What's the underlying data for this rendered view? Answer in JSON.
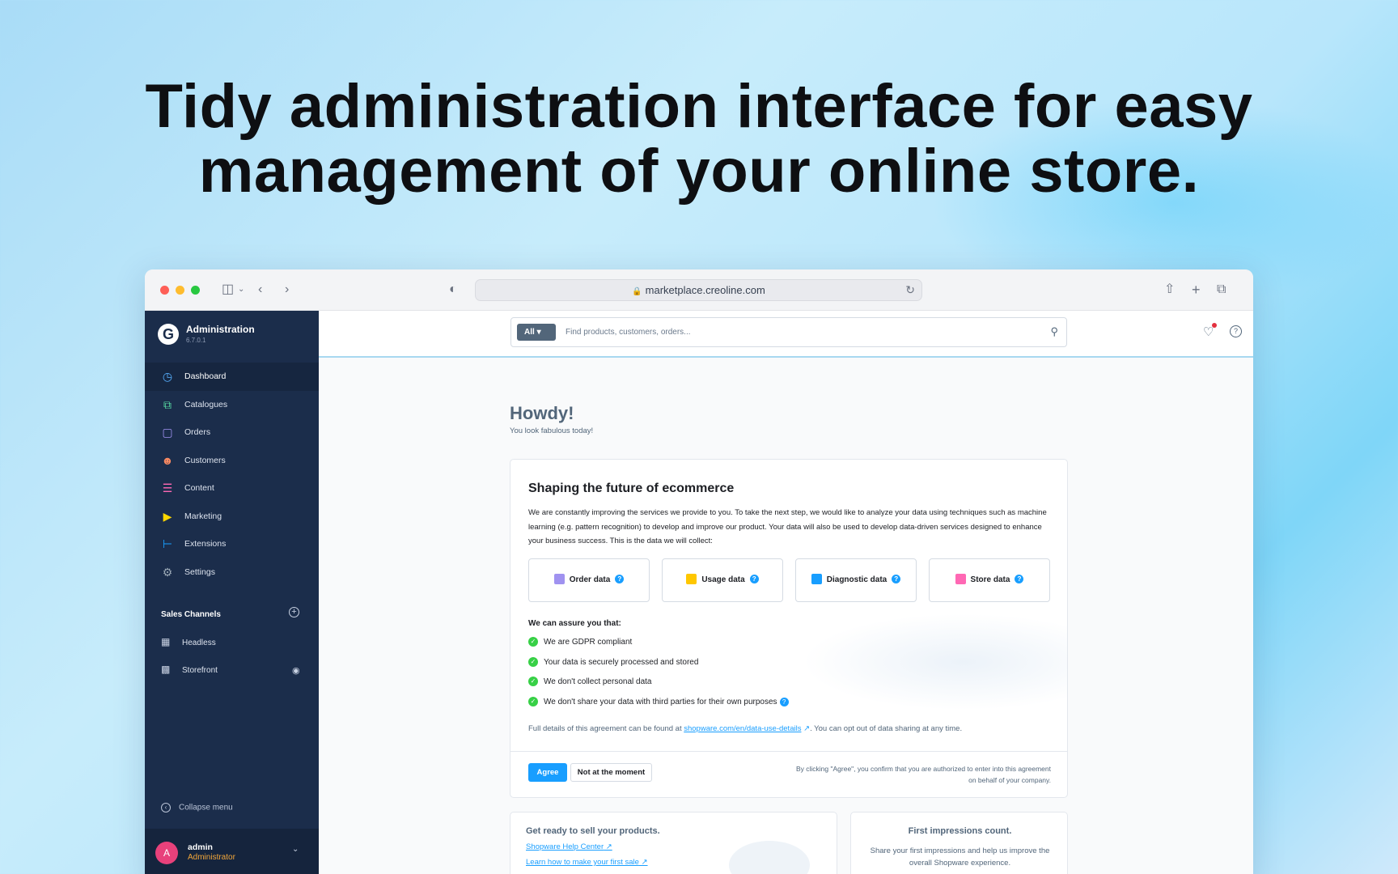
{
  "headline": {
    "line1": "Tidy administration interface for easy",
    "line2": "management of your online store."
  },
  "browser": {
    "url": "marketplace.creoline.com"
  },
  "sidebar": {
    "brand_title": "Administration",
    "brand_version": "6.7.0.1",
    "items": [
      {
        "label": "Dashboard",
        "icon": "gauge-icon",
        "color": "#57b0ff"
      },
      {
        "label": "Catalogues",
        "icon": "copy-icon",
        "color": "#57d9a3"
      },
      {
        "label": "Orders",
        "icon": "bag-icon",
        "color": "#a092f0"
      },
      {
        "label": "Customers",
        "icon": "users-icon",
        "color": "#f88962"
      },
      {
        "label": "Content",
        "icon": "content-icon",
        "color": "#ff68b4"
      },
      {
        "label": "Marketing",
        "icon": "megaphone-icon",
        "color": "#ffd700"
      },
      {
        "label": "Extensions",
        "icon": "plug-icon",
        "color": "#189eff"
      },
      {
        "label": "Settings",
        "icon": "gear-icon",
        "color": "#9aa8b5"
      }
    ],
    "sales_channels_title": "Sales Channels",
    "sales_channels": [
      {
        "label": "Headless",
        "icon": "basket-icon"
      },
      {
        "label": "Storefront",
        "icon": "storefront-icon"
      }
    ],
    "collapse_label": "Collapse menu",
    "user": {
      "initial": "A",
      "name": "admin",
      "role": "Administrator"
    }
  },
  "topbar": {
    "search_scope": "All",
    "search_placeholder": "Find products, customers, orders..."
  },
  "main": {
    "greeting": "Howdy!",
    "subgreeting": "You look fabulous today!",
    "consent": {
      "title": "Shaping the future of ecommerce",
      "intro": "We are constantly improving the services we provide to you. To take the next step, we would like to analyze your data using techniques such as machine learning (e.g. pattern recognition) to develop and improve our product. Your data will also be used to develop data-driven services designed to enhance your business success. This is the data we will collect:",
      "tiles": [
        {
          "label": "Order data",
          "color": "#a092f0"
        },
        {
          "label": "Usage data",
          "color": "#ffc700"
        },
        {
          "label": "Diagnostic data",
          "color": "#189eff"
        },
        {
          "label": "Store data",
          "color": "#ff68b4"
        }
      ],
      "assure_title": "We can assure you that:",
      "assurances": [
        "We are GDPR compliant",
        "Your data is securely processed and stored",
        "We don't collect personal data",
        "We don't share your data with third parties for their own purposes"
      ],
      "details_prefix": "Full details of this agreement can be found at",
      "details_link": "shopware.com/en/data-use-details",
      "details_suffix": ". You can opt out of data sharing at any time.",
      "agree_label": "Agree",
      "not_now_label": "Not at the moment",
      "footnote": "By clicking \"Agree\", you confirm that you are authorized to enter into this agreement on behalf of your company."
    },
    "sell_card": {
      "title": "Get ready to sell your products.",
      "link1": "Shopware Help Center",
      "link2": "Learn how to make your first sale"
    },
    "impressions_card": {
      "title": "First impressions count.",
      "body": "Share your first impressions and help us improve the overall Shopware experience."
    }
  }
}
